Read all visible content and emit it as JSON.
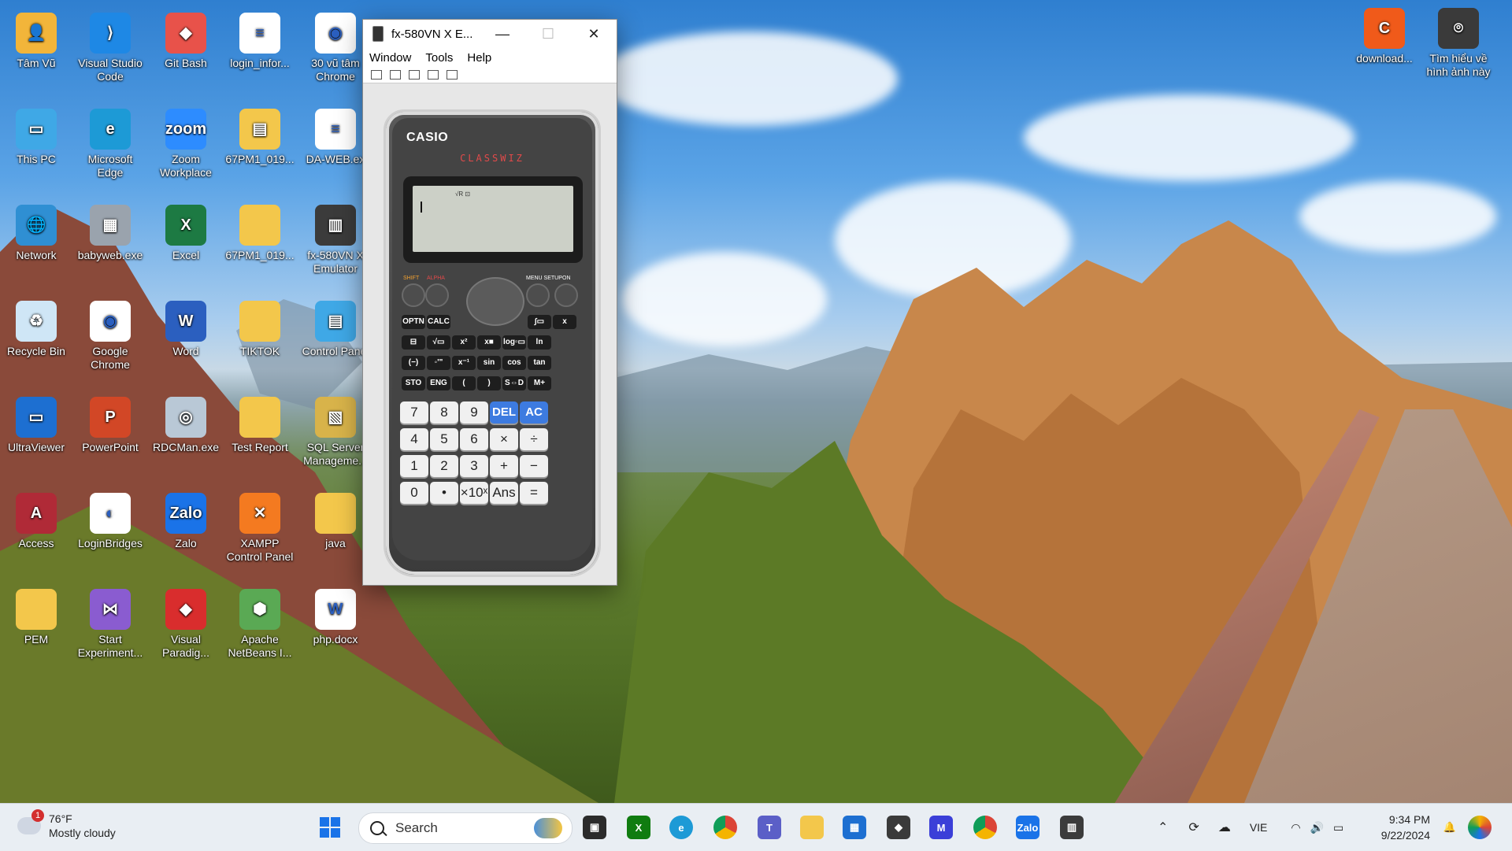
{
  "desktop": {
    "icons": [
      {
        "name": "tam-vu",
        "label": "Tâm Vũ",
        "color": "#f2b53a",
        "glyph": "👤",
        "badge": "none"
      },
      {
        "name": "visual-studio-code",
        "label": "Visual Studio Code",
        "color": "#1e88e5",
        "glyph": "⟩",
        "badge": "check"
      },
      {
        "name": "git-bash",
        "label": "Git Bash",
        "color": "#e8524a",
        "glyph": "◆",
        "badge": "shortcut"
      },
      {
        "name": "login-info",
        "label": "login_infor...",
        "color": "#ffffff",
        "glyph": "≡",
        "badge": "check"
      },
      {
        "name": "chrome-30-vu-tam",
        "label": "30 vũ tâm Chrome",
        "color": "#ffffff",
        "glyph": "◉",
        "badge": "none"
      },
      {
        "name": "this-pc",
        "label": "This PC",
        "color": "#3fa8e6",
        "glyph": "▭",
        "badge": "none"
      },
      {
        "name": "microsoft-edge",
        "label": "Microsoft Edge",
        "color": "#1d9ad6",
        "glyph": "e",
        "badge": "none"
      },
      {
        "name": "zoom-workplace",
        "label": "Zoom Workplace",
        "color": "#2d8cff",
        "glyph": "zoom",
        "badge": "none"
      },
      {
        "name": "67pm1-019-zip",
        "label": "67PM1_019...",
        "color": "#f3c74b",
        "glyph": "▤",
        "badge": "check"
      },
      {
        "name": "da-web",
        "label": "DA-WEB.ex",
        "color": "#ffffff",
        "glyph": "≡",
        "badge": "check"
      },
      {
        "name": "network",
        "label": "Network",
        "color": "#2f8fd3",
        "glyph": "🌐",
        "badge": "none"
      },
      {
        "name": "babyweb",
        "label": "babyweb.exe",
        "color": "#9aa3ad",
        "glyph": "▦",
        "badge": "check"
      },
      {
        "name": "excel",
        "label": "Excel",
        "color": "#1d7a43",
        "glyph": "X",
        "badge": "none"
      },
      {
        "name": "67pm1-019-folder",
        "label": "67PM1_019...",
        "color": "#f3c74b",
        "glyph": "",
        "badge": "check"
      },
      {
        "name": "fx580vn-emulator",
        "label": "fx-580VN X Emulator",
        "color": "#3b3b3b",
        "glyph": "▥",
        "badge": "shortcut"
      },
      {
        "name": "recycle-bin",
        "label": "Recycle Bin",
        "color": "#cfe6f6",
        "glyph": "♻",
        "badge": "none"
      },
      {
        "name": "google-chrome",
        "label": "Google Chrome",
        "color": "#ffffff",
        "glyph": "◉",
        "badge": "shortcut"
      },
      {
        "name": "word",
        "label": "Word",
        "color": "#2b5fbf",
        "glyph": "W",
        "badge": "check"
      },
      {
        "name": "tiktok",
        "label": "TIKTOK",
        "color": "#f3c74b",
        "glyph": "",
        "badge": "none"
      },
      {
        "name": "control-panel",
        "label": "Control Panel",
        "color": "#3fa8e6",
        "glyph": "▤",
        "badge": "none"
      },
      {
        "name": "ultraviewer",
        "label": "UltraViewer",
        "color": "#1d6fd1",
        "glyph": "▭",
        "badge": "shortcut"
      },
      {
        "name": "powerpoint",
        "label": "PowerPoint",
        "color": "#d24726",
        "glyph": "P",
        "badge": "check"
      },
      {
        "name": "rdcman",
        "label": "RDCMan.exe",
        "color": "#b9c8d6",
        "glyph": "◎",
        "badge": "check"
      },
      {
        "name": "test-report",
        "label": "Test Report",
        "color": "#f3c74b",
        "glyph": "",
        "badge": "check"
      },
      {
        "name": "sql-server",
        "label": "SQL Server Manageme...",
        "color": "#d8b34a",
        "glyph": "▧",
        "badge": "check"
      },
      {
        "name": "access",
        "label": "Access",
        "color": "#b02a37",
        "glyph": "A",
        "badge": "check"
      },
      {
        "name": "loginbridges",
        "label": "LoginBridges",
        "color": "#ffffff",
        "glyph": "◐",
        "badge": "check"
      },
      {
        "name": "zalo",
        "label": "Zalo",
        "color": "#1a73e8",
        "glyph": "Zalo",
        "badge": "check"
      },
      {
        "name": "xampp",
        "label": "XAMPP Control Panel",
        "color": "#f47a20",
        "glyph": "✕",
        "badge": "none"
      },
      {
        "name": "java",
        "label": "java",
        "color": "#f3c74b",
        "glyph": "",
        "badge": "check"
      },
      {
        "name": "pem",
        "label": "PEM",
        "color": "#f3c74b",
        "glyph": "",
        "badge": "check"
      },
      {
        "name": "start-experiment",
        "label": "Start Experiment...",
        "color": "#8a5cd0",
        "glyph": "⋈",
        "badge": "check"
      },
      {
        "name": "visual-paradigm",
        "label": "Visual Paradig...",
        "color": "#d92d2d",
        "glyph": "◆",
        "badge": "check"
      },
      {
        "name": "apache-netbeans",
        "label": "Apache NetBeans I...",
        "color": "#5aa954",
        "glyph": "⬢",
        "badge": "shortcut"
      },
      {
        "name": "php-docx",
        "label": "php.docx",
        "color": "#ffffff",
        "glyph": "W",
        "badge": "check"
      }
    ],
    "right_icons": [
      {
        "name": "download-c",
        "label": "download...",
        "color": "#f05a1a",
        "glyph": "C",
        "badge": "check"
      },
      {
        "name": "tim-hieu-ve-hinh-anh",
        "label": "Tìm hiểu về hình ảnh này",
        "color": "#3a3a3a",
        "glyph": "⌾",
        "badge": "none"
      }
    ]
  },
  "window": {
    "title": "fx-580VN X E...",
    "minimize": "—",
    "maximize": "☐",
    "close": "✕",
    "menu": [
      "Window",
      "Tools",
      "Help"
    ]
  },
  "calculator": {
    "brand": "CASIO",
    "series": "CLASSWIZ",
    "screen_indicator": "√R ⊡",
    "top_labels": {
      "shift": "SHIFT",
      "alpha": "ALPHA",
      "menu_setup": "MENU SETUP",
      "on": "ON"
    },
    "func_row1": [
      "OPTN",
      "CALC",
      "∫▭",
      "x"
    ],
    "func_row2": [
      "⊟",
      "√▭",
      "x²",
      "x■",
      "log▫▭",
      "ln"
    ],
    "func_row3": [
      "(−)",
      "◦'\"",
      "x⁻¹",
      "sin",
      "cos",
      "tan"
    ],
    "func_row4": [
      "STO",
      "ENG",
      "(",
      ")",
      "S⇔D",
      "M+"
    ],
    "num_row1": [
      "7",
      "8",
      "9",
      "DEL",
      "AC"
    ],
    "num_row2": [
      "4",
      "5",
      "6",
      "×",
      "÷"
    ],
    "num_row3": [
      "1",
      "2",
      "3",
      "+",
      "−"
    ],
    "num_row4": [
      "0",
      "•",
      "×10ˣ",
      "Ans",
      "="
    ]
  },
  "taskbar": {
    "weather_badge": "1",
    "temperature": "76°F",
    "condition": "Mostly cloudy",
    "search_placeholder": "Search",
    "language": "VIE",
    "time": "9:34 PM",
    "date": "9/22/2024"
  }
}
